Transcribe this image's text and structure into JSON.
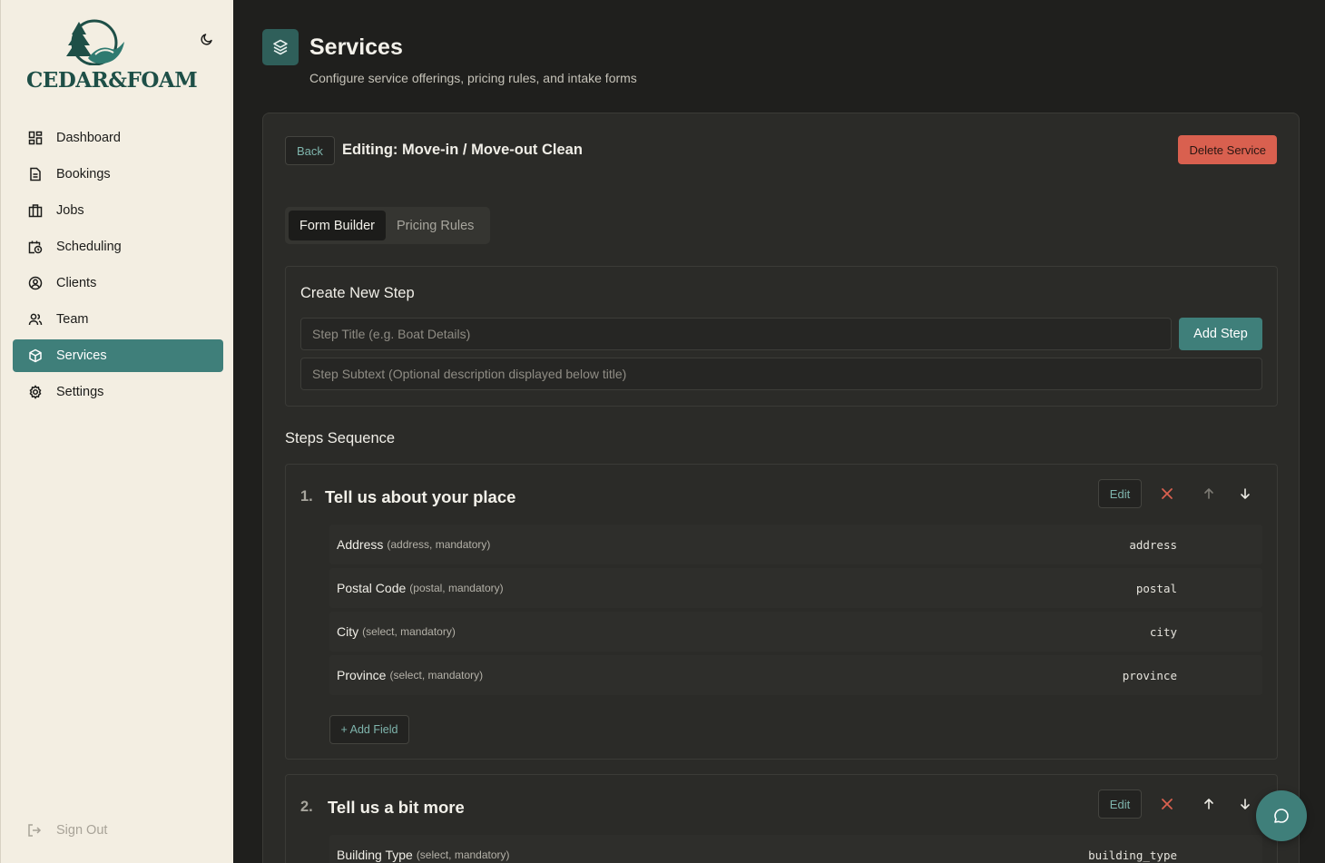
{
  "brand": {
    "name": "CEDAR&FOAM",
    "accent": "#3f7f7a"
  },
  "nav": {
    "items": [
      {
        "label": "Dashboard",
        "icon": "dashboard-icon"
      },
      {
        "label": "Bookings",
        "icon": "document-icon"
      },
      {
        "label": "Jobs",
        "icon": "briefcase-icon"
      },
      {
        "label": "Scheduling",
        "icon": "calendar-clock-icon"
      },
      {
        "label": "Clients",
        "icon": "user-circle-icon"
      },
      {
        "label": "Team",
        "icon": "users-icon"
      },
      {
        "label": "Services",
        "icon": "package-icon",
        "active": true
      },
      {
        "label": "Settings",
        "icon": "gear-icon"
      }
    ],
    "sign_out": "Sign Out"
  },
  "header": {
    "title": "Services",
    "subtitle": "Configure service offerings, pricing rules, and intake forms"
  },
  "editor": {
    "back_label": "Back",
    "editing_title": "Editing: Move-in / Move-out Clean",
    "delete_label": "Delete Service",
    "tabs": [
      {
        "label": "Form Builder",
        "active": true
      },
      {
        "label": "Pricing Rules",
        "active": false
      }
    ]
  },
  "create_step": {
    "title": "Create New Step",
    "title_placeholder": "Step Title (e.g. Boat Details)",
    "subtext_placeholder": "Step Subtext (Optional description displayed below title)",
    "add_label": "Add Step"
  },
  "sequence": {
    "title": "Steps Sequence",
    "edit_label": "Edit",
    "add_field_label": "+ Add Field",
    "steps": [
      {
        "number": "1.",
        "title": "Tell us about your place",
        "fields": [
          {
            "label": "Address",
            "meta": "(address, mandatory)",
            "key": "address"
          },
          {
            "label": "Postal Code",
            "meta": "(postal, mandatory)",
            "key": "postal"
          },
          {
            "label": "City",
            "meta": "(select, mandatory)",
            "key": "city"
          },
          {
            "label": "Province",
            "meta": "(select, mandatory)",
            "key": "province"
          }
        ]
      },
      {
        "number": "2.",
        "title": "Tell us a bit more",
        "fields": [
          {
            "label": "Building Type",
            "meta": "(select, mandatory)",
            "key": "building_type"
          }
        ]
      }
    ]
  }
}
